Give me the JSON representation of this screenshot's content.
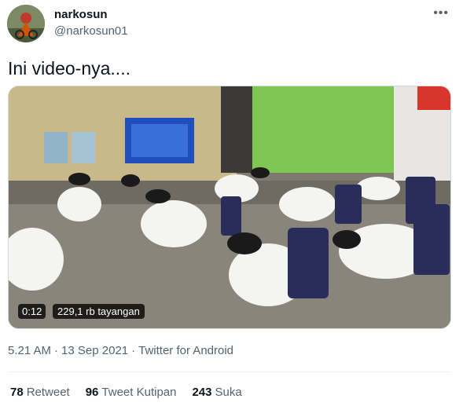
{
  "user": {
    "display_name": "narkosun",
    "handle": "@narkosun01"
  },
  "more_icon": "more-horizontal-icon",
  "tweet": {
    "text": "Ini video-nya...."
  },
  "video": {
    "duration": "0:12",
    "views": "229,1 rb tayangan"
  },
  "meta": {
    "time": "5.21 AM",
    "date": "13 Sep 2021",
    "source": "Twitter for Android"
  },
  "stats": [
    {
      "count": "78",
      "label": "Retweet"
    },
    {
      "count": "96",
      "label": "Tweet Kutipan"
    },
    {
      "count": "243",
      "label": "Suka"
    }
  ],
  "colors": {
    "text": "#0f1419",
    "secondary": "#536471",
    "divider": "#eff3f4"
  }
}
